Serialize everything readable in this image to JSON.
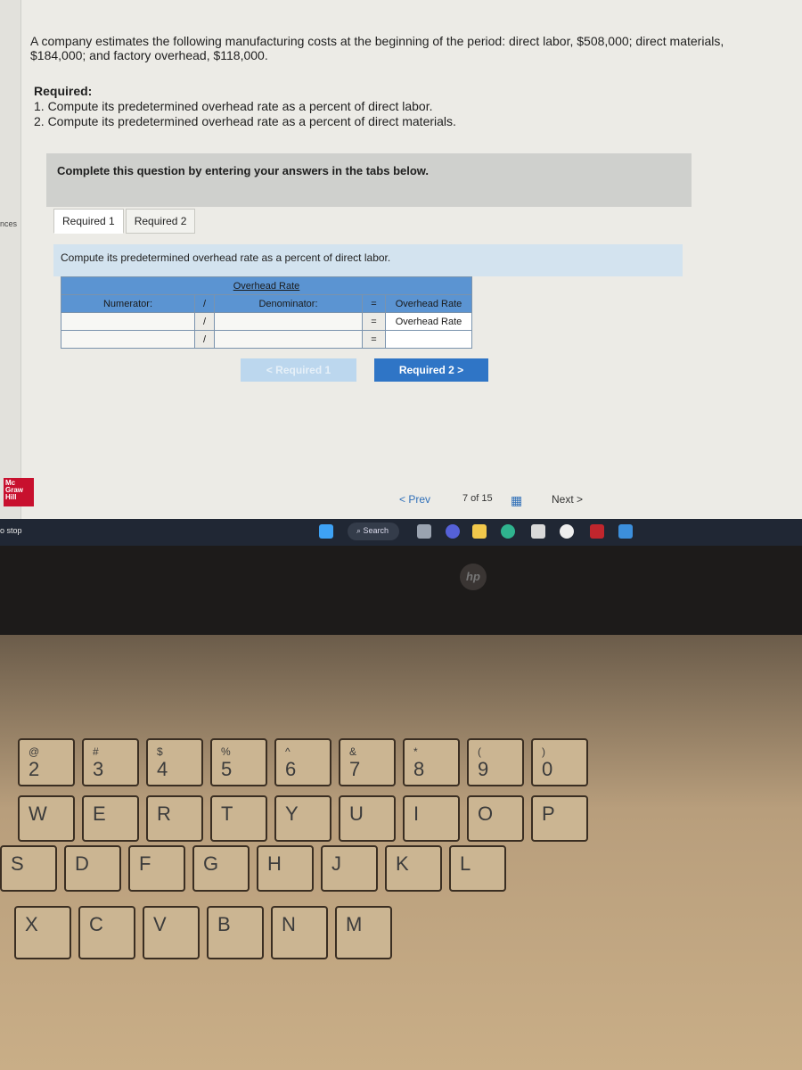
{
  "question": "A company estimates the following manufacturing costs at the beginning of the period: direct labor, $508,000; direct materials, $184,000; and factory overhead, $118,000.",
  "required": {
    "title": "Required:",
    "items": [
      "1. Compute its predetermined overhead rate as a percent of direct labor.",
      "2. Compute its predetermined overhead rate as a percent of direct materials."
    ]
  },
  "banner": "Complete this question by entering your answers in the tabs below.",
  "tabs": [
    {
      "label": "Required 1",
      "active": true
    },
    {
      "label": "Required 2",
      "active": false
    }
  ],
  "instruction": "Compute its predetermined overhead rate as a percent of direct labor.",
  "table": {
    "title": "Overhead Rate",
    "numerator": "Numerator:",
    "slash": "/",
    "denominator": "Denominator:",
    "equals": "=",
    "result_header": "Overhead Rate",
    "rows": [
      {
        "numerator": "",
        "denominator": "",
        "result": "Overhead Rate"
      },
      {
        "numerator": "",
        "denominator": "",
        "result": ""
      }
    ]
  },
  "buttons": {
    "prev": "< Required 1",
    "next": "Required 2 >"
  },
  "pager": {
    "prev": "< Prev",
    "position": "7 of 15",
    "next": "Next >"
  },
  "sidebar": {
    "fragment1": "nces",
    "fragment2": "o stop"
  },
  "logo": "Mc Graw Hill",
  "taskbar": {
    "search": "Search"
  },
  "brand": "hp",
  "keys": {
    "row1": [
      [
        "@",
        "2"
      ],
      [
        "#",
        "3"
      ],
      [
        "$",
        "4"
      ],
      [
        "%",
        "5"
      ],
      [
        "^",
        "6"
      ],
      [
        "&",
        "7"
      ],
      [
        "*",
        "8"
      ],
      [
        "(",
        "9"
      ],
      [
        ")",
        "0"
      ]
    ],
    "row2": [
      "W",
      "E",
      "R",
      "T",
      "Y",
      "U",
      "I",
      "O",
      "P"
    ],
    "row3": [
      "S",
      "D",
      "F",
      "G",
      "H",
      "J",
      "K",
      "L"
    ],
    "row4": [
      "X",
      "C",
      "V",
      "B",
      "N",
      "M"
    ]
  },
  "colors": {
    "header_blue": "#5b94d2",
    "button_blue": "#2f75c6",
    "brand_red": "#c8102e"
  }
}
